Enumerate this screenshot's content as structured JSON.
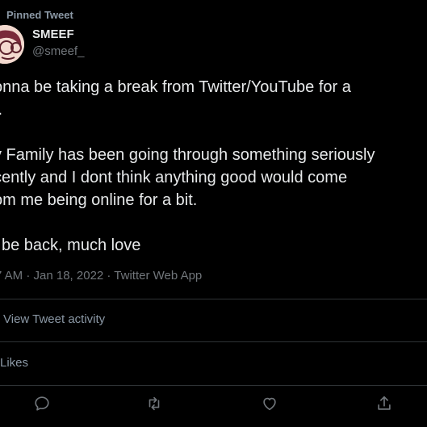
{
  "pinned_label": "Pinned Tweet",
  "author": {
    "name": "SMEEF",
    "handle": "@smeef_"
  },
  "tweet": {
    "lines_para1": [
      "onna be taking a break from Twitter/YouTube for a",
      "t."
    ],
    "lines_para2": [
      "y Family has been going through something seriously",
      "cently and I dont think anything good would come",
      "om me being online for a bit."
    ],
    "lines_para3": [
      "l be back, much love"
    ]
  },
  "meta": "7 AM · Jan 18, 2022 · Twitter Web App",
  "activity_label": "View Tweet activity",
  "likes_label": "Likes",
  "actions": [
    "reply-icon",
    "retweet-icon",
    "like-icon",
    "share-icon"
  ],
  "colors": {
    "background": "#000000",
    "text": "#e7e9ea",
    "secondary": "#71767b",
    "divider": "#2f3336"
  }
}
